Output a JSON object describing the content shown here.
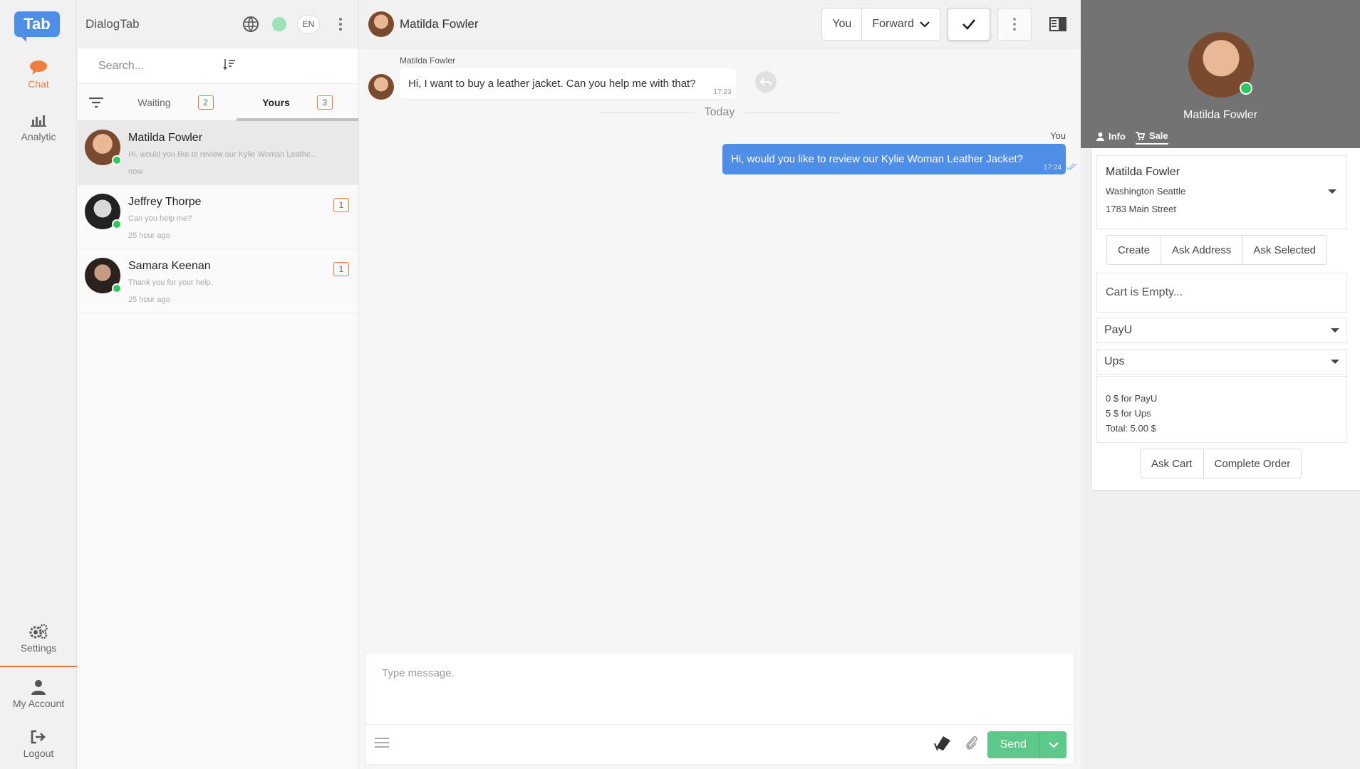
{
  "nav": {
    "logo": "Tab",
    "items": [
      {
        "label": "Chat",
        "icon": "chat-bubble-icon"
      },
      {
        "label": "Analytic",
        "icon": "bar-chart-icon"
      },
      {
        "label": "Settings",
        "icon": "gears-icon"
      },
      {
        "label": "My Account",
        "icon": "user-icon"
      },
      {
        "label": "Logout",
        "icon": "logout-icon"
      }
    ]
  },
  "list": {
    "brand": "DialogTab",
    "language": "EN",
    "search_placeholder": "Search...",
    "tabs": [
      {
        "label": "Waiting",
        "count": "2"
      },
      {
        "label": "Yours",
        "count": "3"
      }
    ],
    "conversations": [
      {
        "name": "Matilda Fowler",
        "preview": "Hi, would you like to review our Kylie Woman Leathe...",
        "time": "now",
        "badge": ""
      },
      {
        "name": "Jeffrey Thorpe",
        "preview": "Can you help me?",
        "time": "25 hour ago",
        "badge": "1"
      },
      {
        "name": "Samara Keenan",
        "preview": "Thank you for your help.",
        "time": "25 hour ago",
        "badge": "1"
      }
    ]
  },
  "chat": {
    "contact_name": "Matilda Fowler",
    "assign_label": "You",
    "forward_label": "Forward",
    "incoming": {
      "sender": "Matilda Fowler",
      "text": "Hi, I want to buy a leather jacket. Can you help me with that?",
      "time": "17:23"
    },
    "day_divider": "Today",
    "outgoing": {
      "sender": "You",
      "text": "Hi, would you like to review our Kylie Woman Leather Jacket?",
      "time": "17:24"
    },
    "composer_placeholder": "Type message.",
    "send_label": "Send"
  },
  "profile": {
    "name": "Matilda Fowler",
    "tabs": [
      "Info",
      "Sale"
    ],
    "address": {
      "name": "Matilda Fowler",
      "city": "Washington Seattle",
      "street": "1783 Main Street"
    },
    "actions": [
      "Create",
      "Ask Address",
      "Ask Selected"
    ],
    "cart_text": "Cart is Empty...",
    "payment": "PayU",
    "shipping": "Ups",
    "summary": [
      "0 $ for PayU",
      "5 $ for Ups",
      "Total: 5.00 $"
    ],
    "order_actions": [
      "Ask Cart",
      "Complete Order"
    ]
  },
  "colors": {
    "accent": "#4f8ee6",
    "orange": "#e9773a",
    "send": "#5cc98a",
    "whatsapp": "#2ec95c"
  }
}
